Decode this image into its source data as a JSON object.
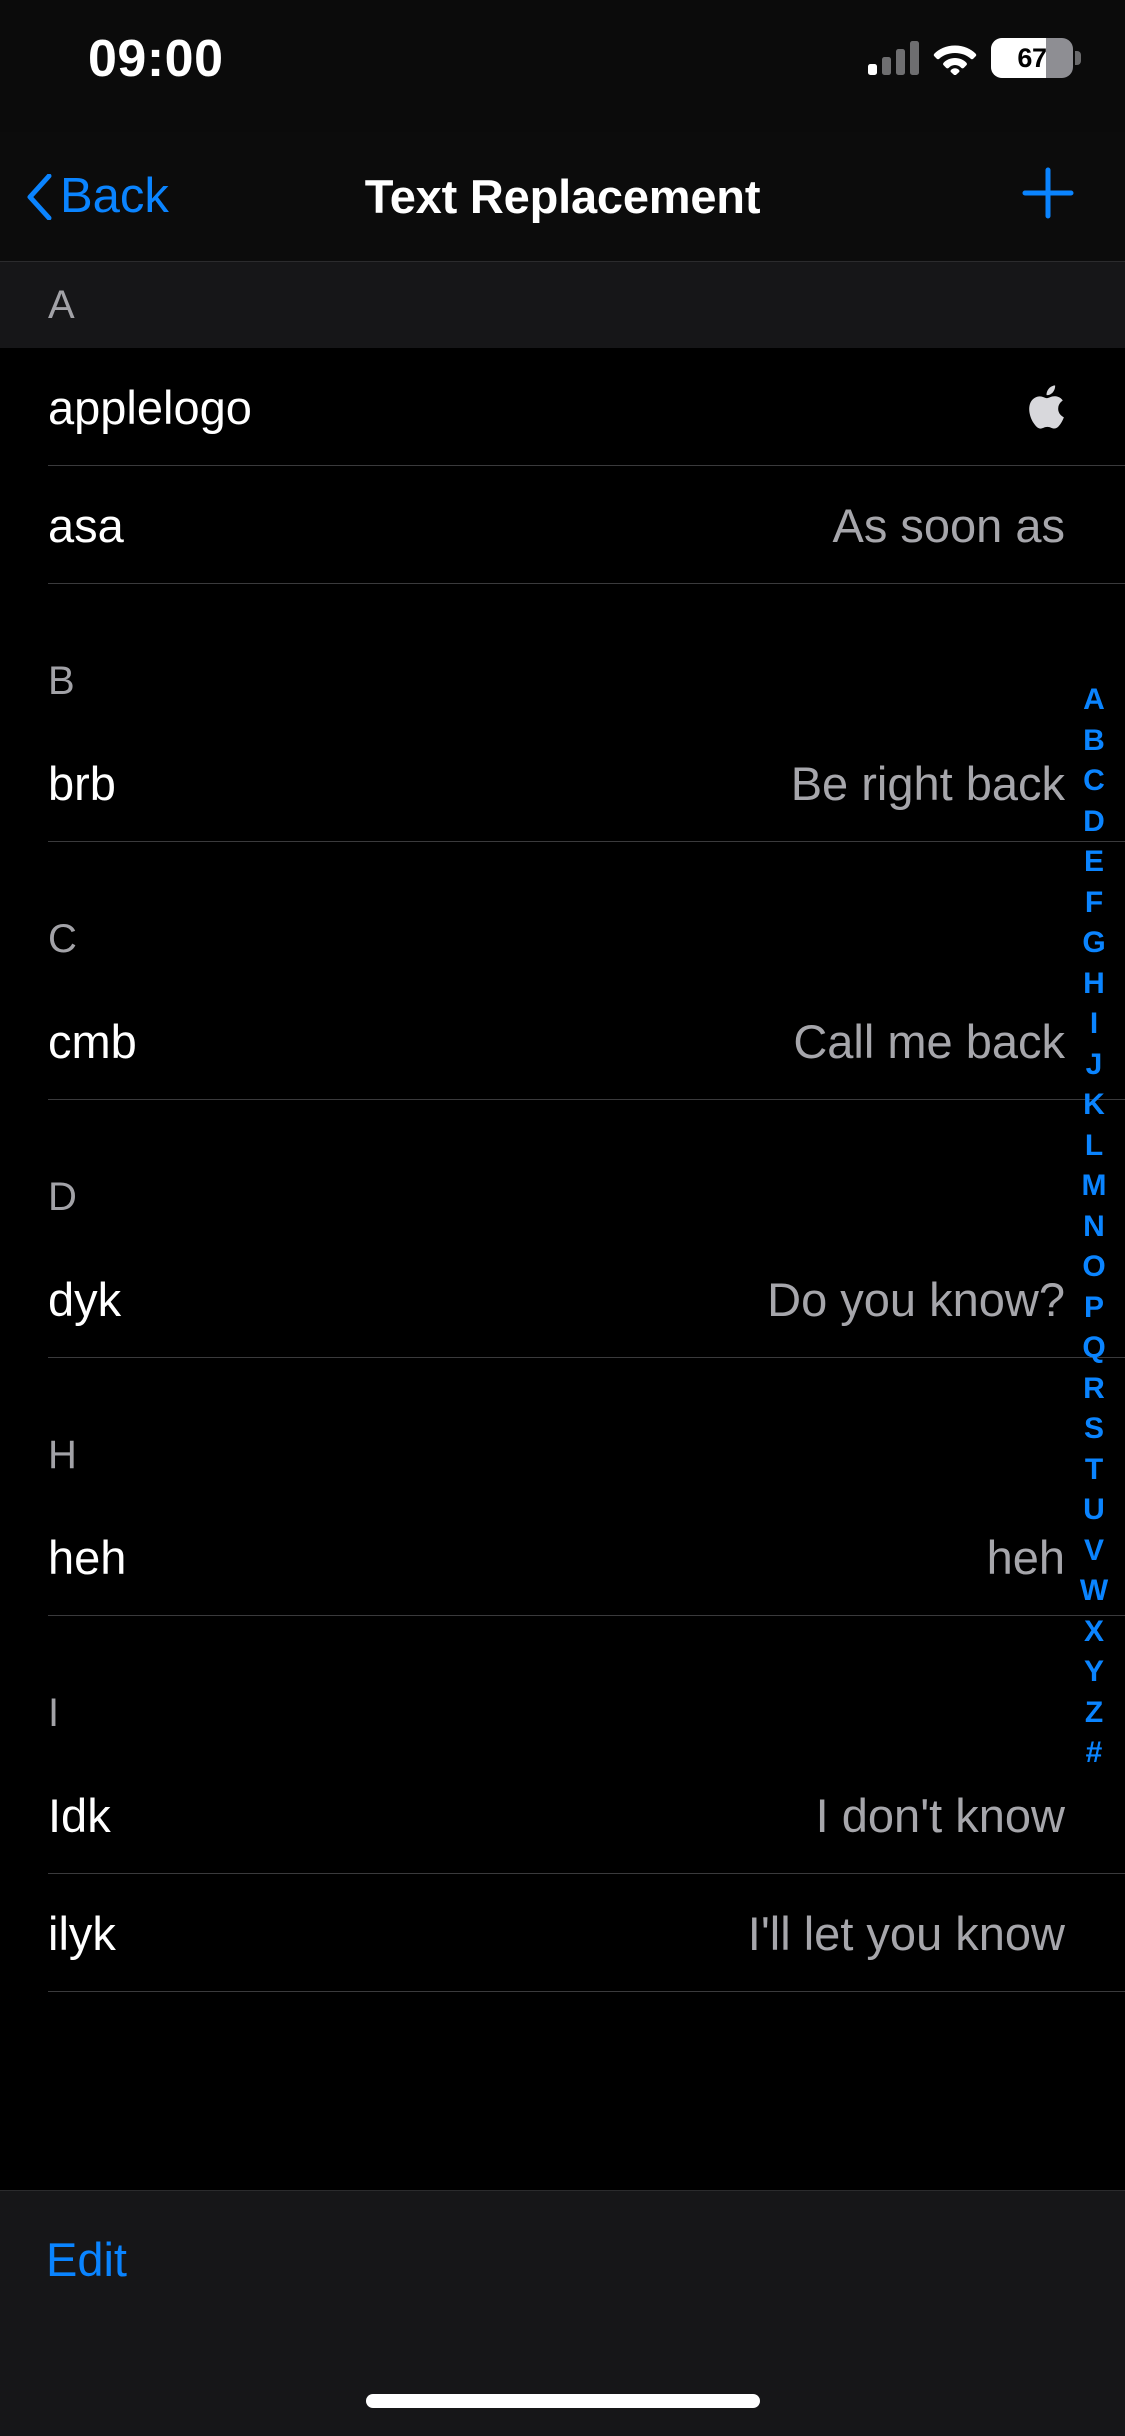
{
  "status_bar": {
    "time": "09:00",
    "battery_percent": "67",
    "battery_level": 67,
    "cellular_icon": "cellular-bars-icon",
    "wifi_icon": "wifi-icon",
    "battery_icon": "battery-icon"
  },
  "nav": {
    "back_label": "Back",
    "back_icon": "chevron-left-icon",
    "title": "Text Replacement",
    "add_label": "+",
    "add_icon": "plus-icon",
    "accent_color": "#0a84ff"
  },
  "sections": [
    {
      "header": "A",
      "header_style": "shaded",
      "rows": [
        {
          "key": "applelogo",
          "value": "",
          "value_kind": "apple-logo-glyph"
        },
        {
          "key": "asa",
          "value": "As soon as",
          "value_kind": "text"
        }
      ]
    },
    {
      "header": "B",
      "header_style": "plain",
      "rows": [
        {
          "key": "brb",
          "value": "Be right back",
          "value_kind": "text"
        }
      ]
    },
    {
      "header": "C",
      "header_style": "plain",
      "rows": [
        {
          "key": "cmb",
          "value": "Call me back",
          "value_kind": "text"
        }
      ]
    },
    {
      "header": "D",
      "header_style": "plain",
      "rows": [
        {
          "key": "dyk",
          "value": "Do you know?",
          "value_kind": "text"
        }
      ]
    },
    {
      "header": "H",
      "header_style": "plain",
      "rows": [
        {
          "key": "heh",
          "value": "heh",
          "value_kind": "text"
        }
      ]
    },
    {
      "header": "I",
      "header_style": "plain",
      "rows": [
        {
          "key": "Idk",
          "value": "I don't know",
          "value_kind": "text"
        },
        {
          "key": "ilyk",
          "value": "I'll let you know",
          "value_kind": "text"
        }
      ]
    }
  ],
  "index_bar": {
    "entries": [
      "A",
      "B",
      "C",
      "D",
      "E",
      "F",
      "G",
      "H",
      "I",
      "J",
      "K",
      "L",
      "M",
      "N",
      "O",
      "P",
      "Q",
      "R",
      "S",
      "T",
      "U",
      "V",
      "W",
      "X",
      "Y",
      "Z",
      "#"
    ],
    "color": "#0a84ff"
  },
  "toolbar": {
    "edit_label": "Edit"
  },
  "colors": {
    "background": "#000000",
    "section_header_bg": "#161618",
    "separator": "#3a3a3c",
    "primary_text": "#ffffff",
    "secondary_text": "#a6a6ab",
    "accent": "#0a84ff",
    "toolbar_bg": "#161618"
  }
}
